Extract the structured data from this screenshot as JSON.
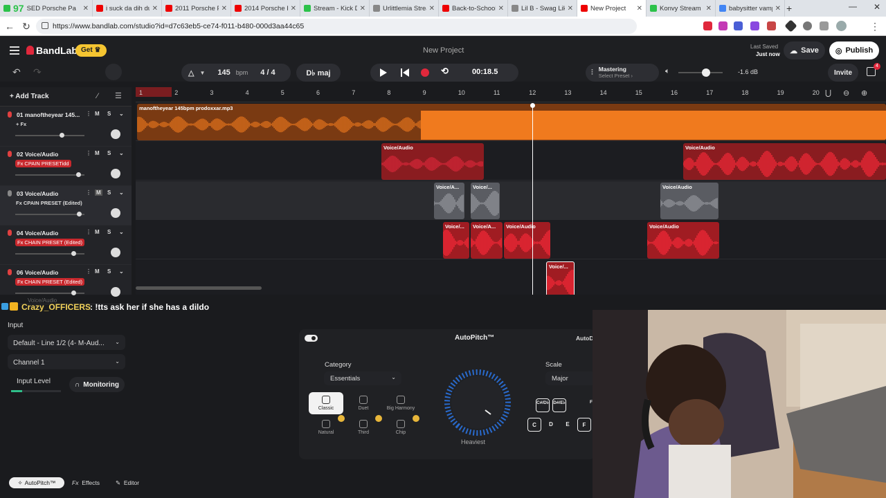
{
  "browser": {
    "tabs": [
      {
        "label": "97",
        "fav": "#2cc24a",
        "logo": true
      },
      {
        "label": "SED Porsche Pa",
        "fav": "#e00"
      },
      {
        "label": "i suck da dih du",
        "fav": "#e00"
      },
      {
        "label": "2011 Porsche Pa",
        "fav": "#e00"
      },
      {
        "label": "2014 Porsche Pa",
        "fav": "#e00"
      },
      {
        "label": "Stream - Kick Da",
        "fav": "#2cc24a"
      },
      {
        "label": "Urlittlemia Strea",
        "fav": "#888"
      },
      {
        "label": "Back-to-School",
        "fav": "#e00"
      },
      {
        "label": "Lil B - Swag Like",
        "fav": "#888"
      },
      {
        "label": "New Project",
        "fav": "#e00",
        "active": true
      },
      {
        "label": "Konvy Stream",
        "fav": "#2cc24a"
      },
      {
        "label": "babysitter vamp",
        "fav": "#4285f4"
      }
    ],
    "url": "https://www.bandlab.com/studio?id=d7c63eb5-ce74-f011-b480-000d3aa44c65"
  },
  "header": {
    "brand": "BandLab",
    "get_label": "Get",
    "project_title": "New Project",
    "last_saved_label": "Last Saved",
    "last_saved_value": "Just now",
    "save_label": "Save",
    "publish_label": "Publish"
  },
  "toolbar": {
    "bpm": "145",
    "bpm_unit": "bpm",
    "time_sig": "4 / 4",
    "key": "D♭ maj",
    "time": "00:18.5",
    "mastering_label": "Mastering",
    "mastering_sub": "Select Preset",
    "volume_db": "-1.6 dB",
    "invite_label": "Invite",
    "notif_count": "4",
    "add_track_label": "Add Track"
  },
  "ruler": [
    "1",
    "2",
    "3",
    "4",
    "5",
    "6",
    "7",
    "8",
    "9",
    "10",
    "11",
    "12",
    "13",
    "14",
    "15",
    "16",
    "17",
    "18",
    "19",
    "20"
  ],
  "tracks": [
    {
      "name": "01  manoftheyear 145...",
      "fx": "+ Fx",
      "fx_style": "plain",
      "vol": 0.68
    },
    {
      "name": "02  Voice/Audio",
      "fx": "Fx CPAIN PRESETidd",
      "fx_style": "red",
      "vol": 0.92
    },
    {
      "name": "03  Voice/Audio",
      "fx": "Fx CPAIN PRESET (Edited)",
      "fx_style": "plain",
      "vol": 0.93
    },
    {
      "name": "04  Voice/Audio",
      "fx": "Fx CHAIN PRESET (Edited)",
      "fx_style": "red",
      "vol": 0.85
    },
    {
      "name": "06  Voice/Audio",
      "fx": "Fx CHAIN PRESET (Edited)",
      "fx_style": "red",
      "vol": 0.85
    }
  ],
  "clips": {
    "main": "manoftheyear 145bpm prodoxxar.mp3",
    "voice": "Voice/Audio",
    "voice_short": "Voice/A...",
    "voice_short2": "Voice/..."
  },
  "hidden_track_label": "Voice/Audio",
  "chat": {
    "user": "Crazy_OFFICERS",
    "message": ": !tts ask her if she has a dildo"
  },
  "input_panel": {
    "title": "Input",
    "device": "Default - Line 1/2 (4- M-Aud...",
    "channel": "Channel 1",
    "level_label": "Input Level",
    "monitoring_label": "Monitoring"
  },
  "autopitch": {
    "title": "AutoPitch™",
    "title_right": "AutoD",
    "category_label": "Category",
    "category_value": "Essentials",
    "presets": [
      "Classic",
      "Duet",
      "Big Harmony",
      "Natural",
      "Third",
      "Chip"
    ],
    "dial_label": "Heaviest",
    "scale_label": "Scale",
    "scale_value": "Major",
    "keys_top": [
      "C#/D♭",
      "D#/E♭",
      "F"
    ],
    "keys_bottom": [
      "C",
      "D",
      "E",
      "F"
    ]
  },
  "bottom_tabs": [
    "AutoPitch™",
    "Effects",
    "Editor"
  ],
  "colors": {
    "accent_orange": "#f07a1e",
    "clip_red": "#c8282d",
    "clip_gray": "#5a5c62",
    "record_red": "#e0283c"
  }
}
